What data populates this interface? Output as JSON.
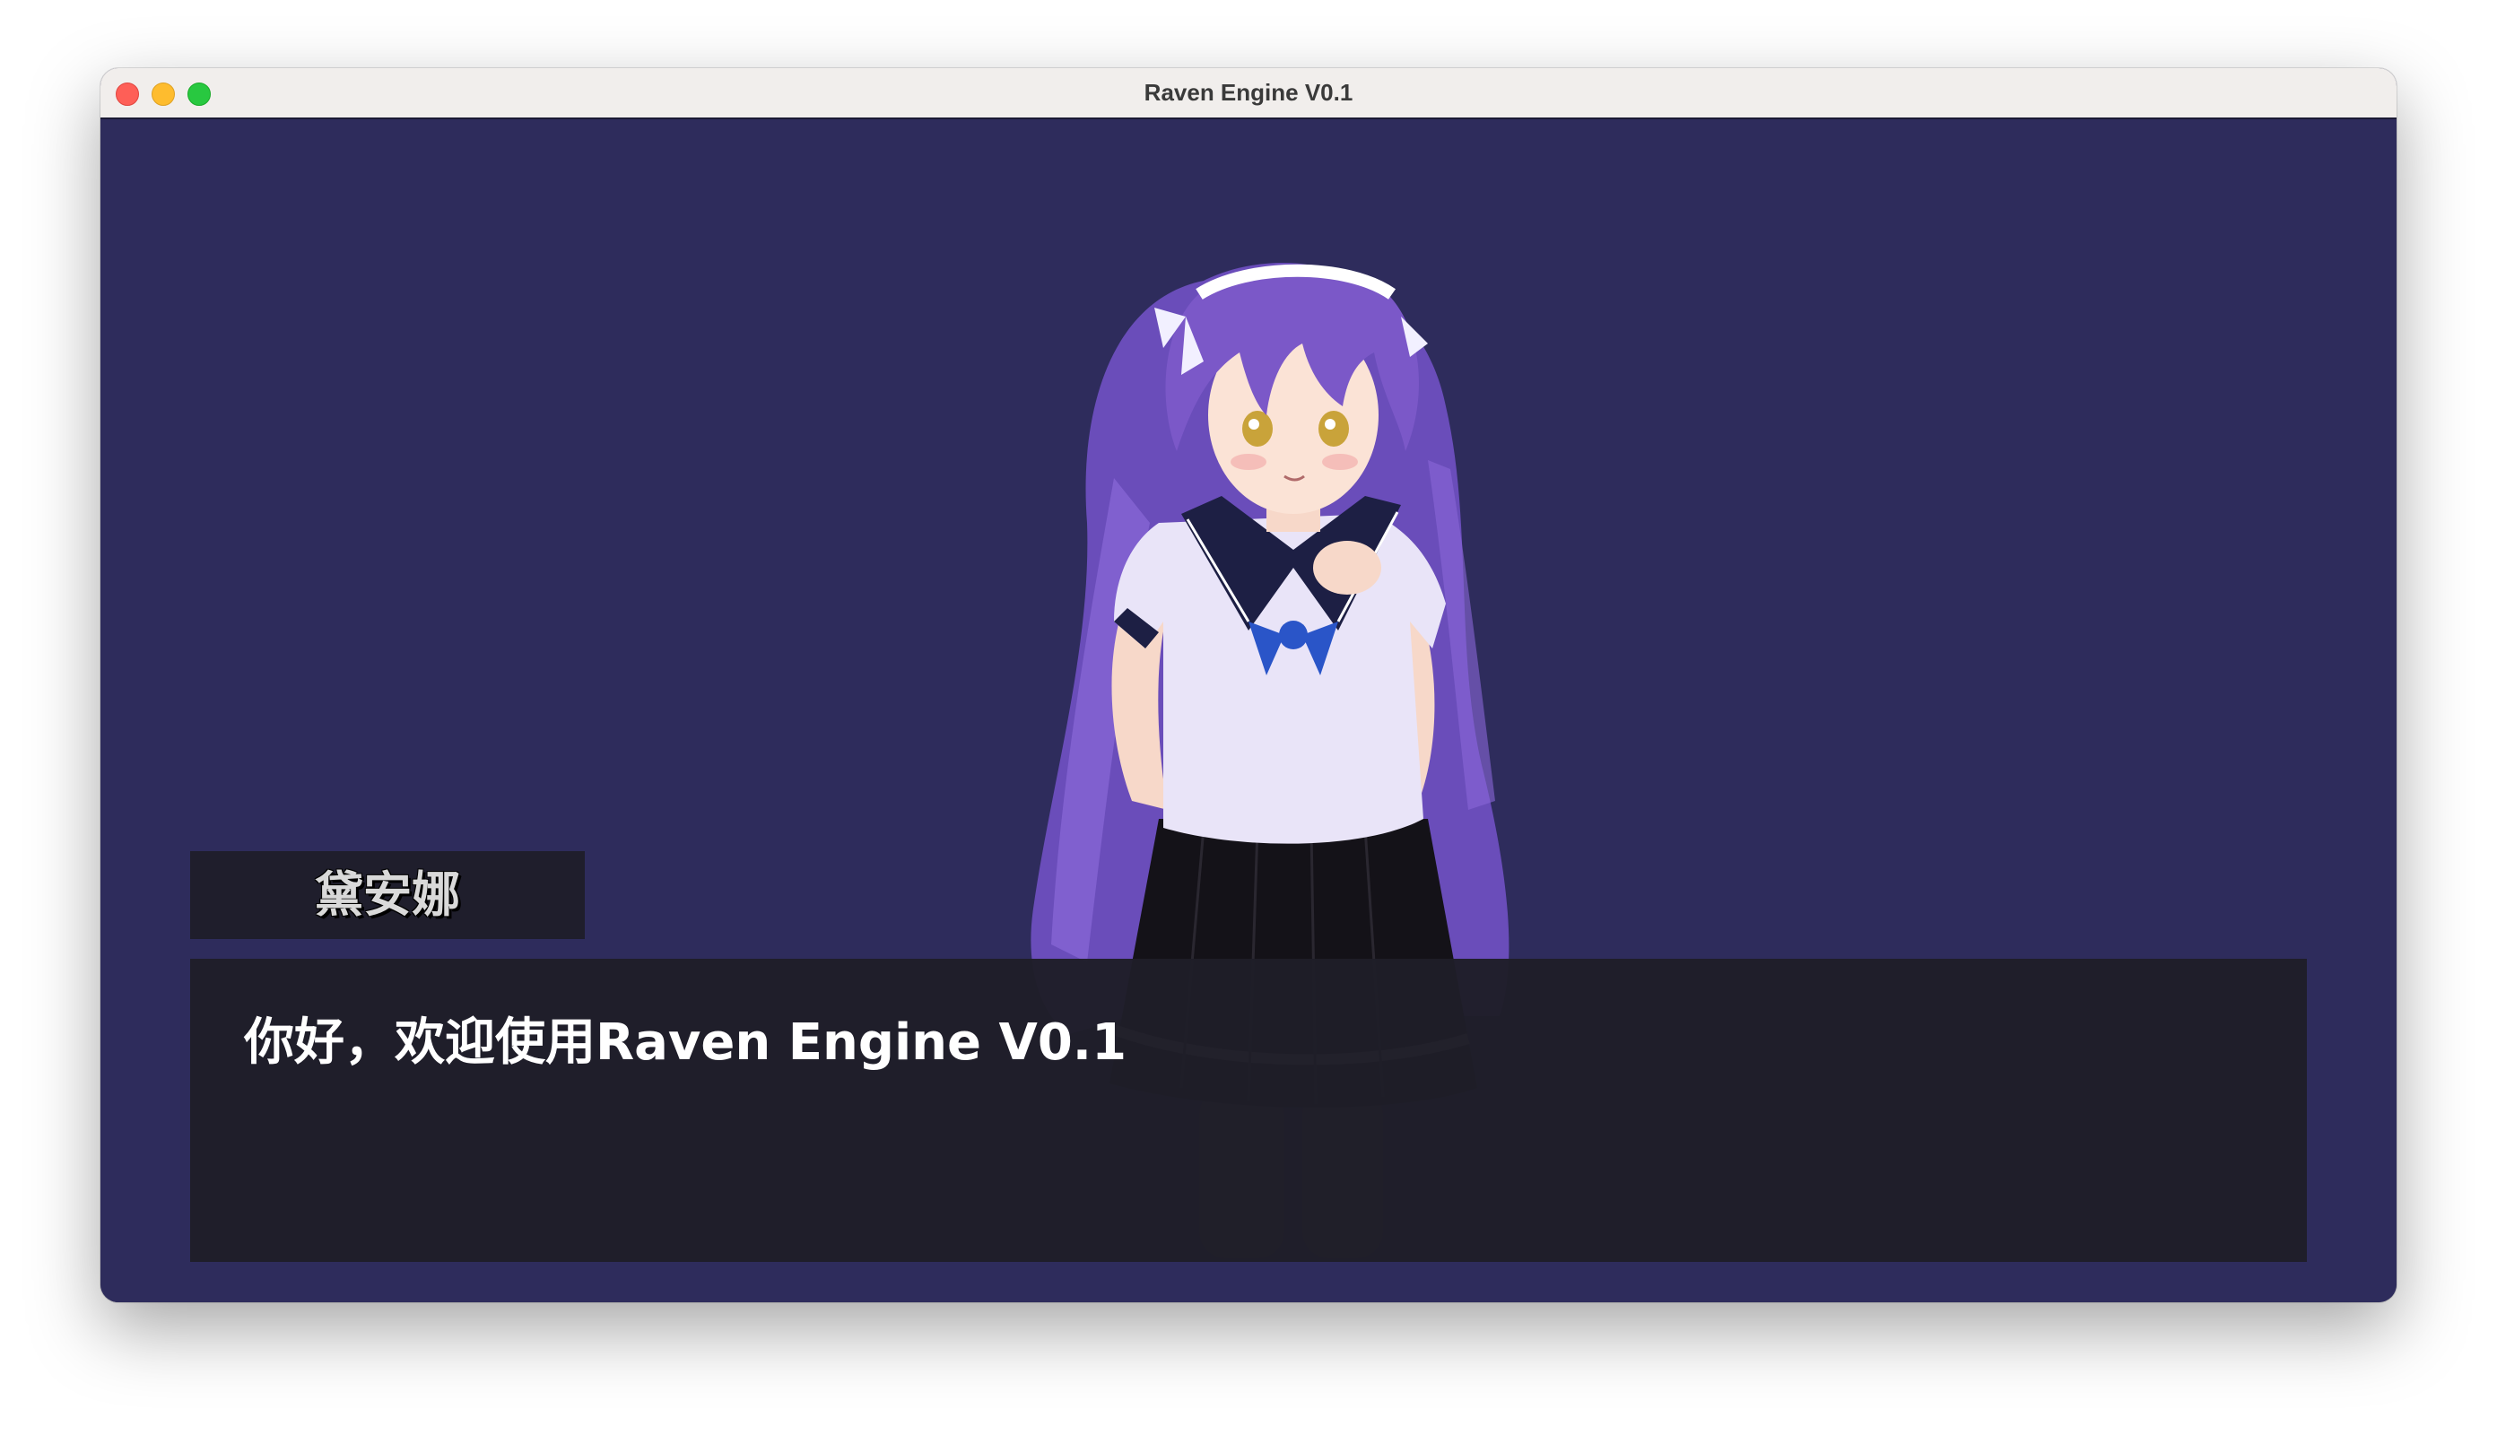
{
  "window": {
    "title": "Raven Engine V0.1"
  },
  "stage": {
    "background_color": "#2e2c5c",
    "character": {
      "description_icon": "anime-schoolgirl-sprite",
      "hair_color": "#7b58c8",
      "uniform_color": "#e9e4f8",
      "skirt_color": "#141218",
      "bow_color": "#2a55c8"
    }
  },
  "dialogue": {
    "speaker_name": "黛安娜",
    "text": "你好，欢迎使用Raven Engine V0.1"
  }
}
